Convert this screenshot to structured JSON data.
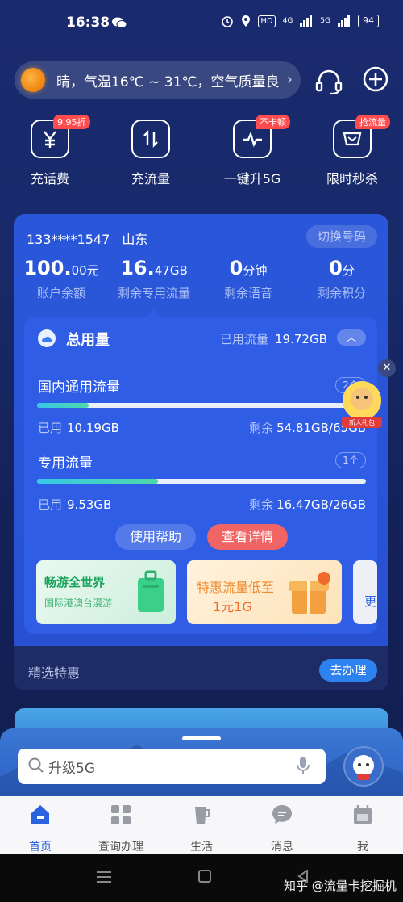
{
  "status_bar": {
    "time": "16:38",
    "hd": "HD",
    "net1": "4G",
    "net2": "5G",
    "battery": "94"
  },
  "header": {
    "weather_text": "晴，气温16℃ ~ 31℃，空气质量良",
    "service_icon": "headset-icon",
    "add_icon": "plus-circle-icon"
  },
  "quick_actions": [
    {
      "label": "充话费",
      "badge": "9.95折",
      "icon": "yuan-icon"
    },
    {
      "label": "充流量",
      "badge": "",
      "icon": "updown-arrows-icon"
    },
    {
      "label": "一键升5G",
      "badge": "不卡顿",
      "icon": "pulse-icon"
    },
    {
      "label": "限时秒杀",
      "badge": "抢流量",
      "icon": "gift-box-icon"
    }
  ],
  "account": {
    "phone": "133****1547",
    "province": "山东",
    "switch_label": "切换号码",
    "stats": [
      {
        "value": "100.",
        "unit": "00元",
        "label": "账户余额"
      },
      {
        "value": "16.",
        "unit": "47GB",
        "label": "剩余专用流量"
      },
      {
        "value": "0",
        "unit": "分钟",
        "label": "剩余语音"
      },
      {
        "value": "0",
        "unit": "分",
        "label": "剩余积分"
      }
    ]
  },
  "usage": {
    "title": "总用量",
    "used_label": "已用流量",
    "used_value": "19.72GB",
    "sections": [
      {
        "title": "国内通用流量",
        "count": "2个",
        "used_label": "已用",
        "used_value": "10.19GB",
        "remain_label": "剩余",
        "remain_value": "54.81GB/65GB",
        "fraction": 0.157
      },
      {
        "title": "专用流量",
        "count": "1个",
        "used_label": "已用",
        "used_value": "9.53GB",
        "remain_label": "剩余",
        "remain_value": "16.47GB/26GB",
        "fraction": 0.367
      }
    ],
    "help_label": "使用帮助",
    "detail_label": "查看详情"
  },
  "promos": [
    {
      "title": "畅游全世界",
      "subtitle": "国际港澳台漫游"
    },
    {
      "title": "特惠流量低至",
      "subtitle": "1元1G"
    },
    {
      "title": "更",
      "subtitle": ""
    }
  ],
  "selected": {
    "label": "精选特惠",
    "go_label": "去办理"
  },
  "floating": {
    "gift_label": "新人礼包"
  },
  "dock": {
    "search_placeholder": "升级5G"
  },
  "tabs": [
    {
      "label": "首页",
      "active": true
    },
    {
      "label": "查询办理",
      "active": false
    },
    {
      "label": "生活",
      "active": false
    },
    {
      "label": "消息",
      "active": false
    },
    {
      "label": "我",
      "active": false
    }
  ],
  "watermark": "知乎 @流量卡挖掘机",
  "colors": {
    "accent": "#2a62e0",
    "detail_button": "#f06464",
    "go_button": "#2e82f0",
    "card": "#2a56d9"
  }
}
